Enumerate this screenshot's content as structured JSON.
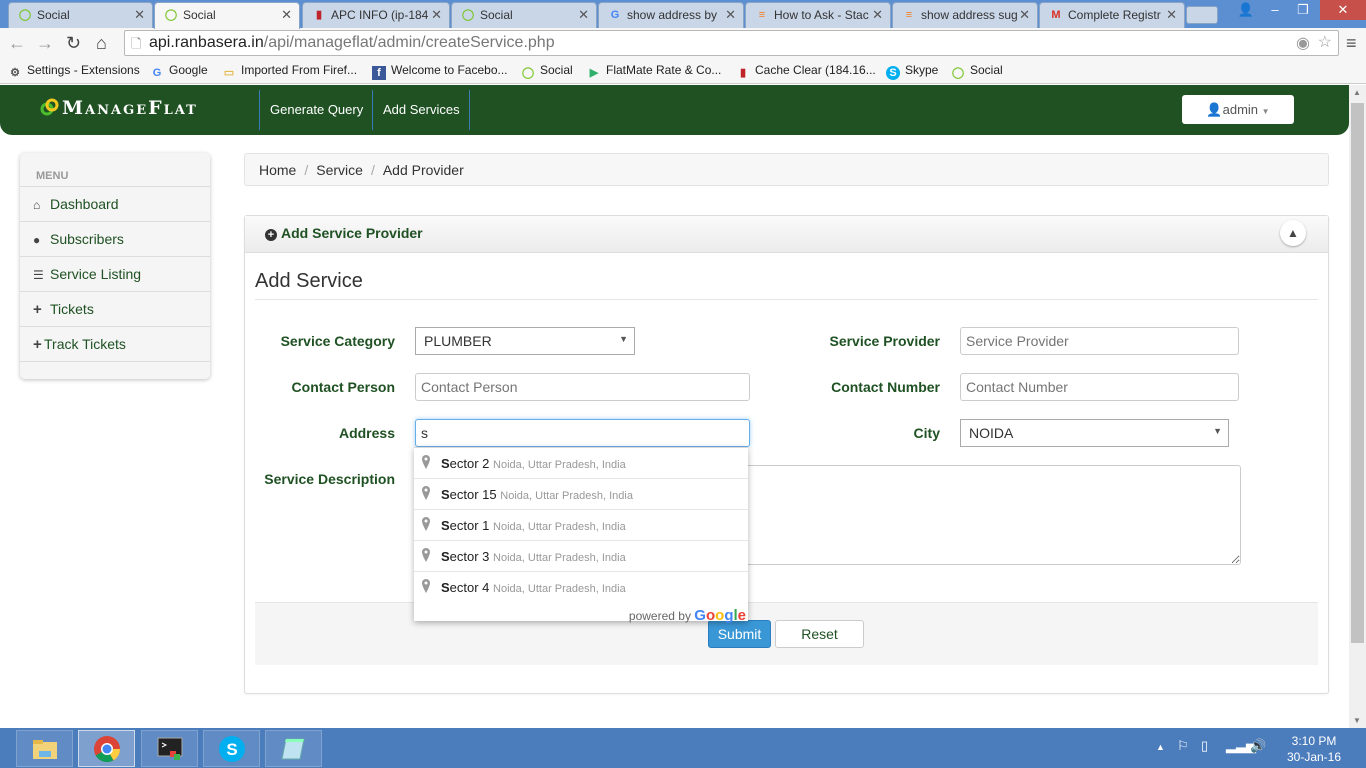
{
  "browser": {
    "tabs": [
      {
        "title": "Social",
        "icon": "social-icon",
        "active": false
      },
      {
        "title": "Social",
        "icon": "social-icon",
        "active": true
      },
      {
        "title": "APC INFO (ip-184",
        "icon": "extinguisher-icon",
        "active": false
      },
      {
        "title": "Social",
        "icon": "social-icon",
        "active": false
      },
      {
        "title": "show address by",
        "icon": "google-icon",
        "active": false
      },
      {
        "title": "How to Ask - Stac",
        "icon": "stackoverflow-icon",
        "active": false
      },
      {
        "title": "show address sug",
        "icon": "stackoverflow-icon",
        "active": false
      },
      {
        "title": "Complete Registr",
        "icon": "gmail-icon",
        "active": false
      }
    ],
    "url_host": "api.ranbasera.in",
    "url_path": "/api/manageflat/admin/createService.php",
    "bookmarks": [
      {
        "label": "Settings - Extensions",
        "icon": "gear-icon"
      },
      {
        "label": "Google",
        "icon": "google-icon"
      },
      {
        "label": "Imported From Firef...",
        "icon": "folder-icon"
      },
      {
        "label": "Welcome to Facebo...",
        "icon": "facebook-icon"
      },
      {
        "label": "Social",
        "icon": "social-icon"
      },
      {
        "label": "FlatMate Rate & Co...",
        "icon": "play-store-icon"
      },
      {
        "label": "Cache Clear (184.16...",
        "icon": "extinguisher-icon"
      },
      {
        "label": "Skype",
        "icon": "skype-icon"
      },
      {
        "label": "Social",
        "icon": "social-icon"
      }
    ]
  },
  "app": {
    "brand": "ManageFlat",
    "nav": [
      {
        "label": "Generate Query"
      },
      {
        "label": "Add Services"
      }
    ],
    "user": "admin",
    "colors": {
      "primary": "#1f5123",
      "submit": "#3a97d6"
    }
  },
  "sidebar": {
    "heading": "MENU",
    "items": [
      {
        "label": "Dashboard",
        "icon": "home-icon"
      },
      {
        "label": "Subscribers",
        "icon": "user-icon"
      },
      {
        "label": "Service Listing",
        "icon": "list-icon"
      },
      {
        "label": "Tickets",
        "icon": "plus-icon"
      },
      {
        "label": "Track Tickets",
        "icon": "plus-icon"
      }
    ]
  },
  "breadcrumb": {
    "items": [
      "Home",
      "Service",
      "Add Provider"
    ],
    "separator": "/"
  },
  "panel": {
    "title": "Add Service Provider",
    "form_title": "Add Service",
    "fields": {
      "service_category": {
        "label": "Service Category",
        "value": "PLUMBER"
      },
      "service_provider": {
        "label": "Service Provider",
        "placeholder": "Service Provider",
        "value": ""
      },
      "contact_person": {
        "label": "Contact Person",
        "placeholder": "Contact Person",
        "value": ""
      },
      "contact_number": {
        "label": "Contact Number",
        "placeholder": "Contact Number",
        "value": ""
      },
      "address": {
        "label": "Address",
        "value": "s"
      },
      "city": {
        "label": "City",
        "value": "NOIDA"
      },
      "service_description": {
        "label": "Service Description",
        "value": ""
      }
    },
    "submit_label": "Submit",
    "reset_label": "Reset"
  },
  "autocomplete": {
    "suggestions": [
      {
        "match": "S",
        "rest": "ector 2",
        "secondary": "Noida, Uttar Pradesh, India"
      },
      {
        "match": "S",
        "rest": "ector 15",
        "secondary": "Noida, Uttar Pradesh, India"
      },
      {
        "match": "S",
        "rest": "ector 1",
        "secondary": "Noida, Uttar Pradesh, India"
      },
      {
        "match": "S",
        "rest": "ector 3",
        "secondary": "Noida, Uttar Pradesh, India"
      },
      {
        "match": "S",
        "rest": "ector 4",
        "secondary": "Noida, Uttar Pradesh, India"
      }
    ],
    "powered_by": "powered by",
    "google": [
      "G",
      "o",
      "o",
      "g",
      "l",
      "e"
    ],
    "google_colors": [
      "#4285f4",
      "#ea4335",
      "#fbbc05",
      "#4285f4",
      "#34a853",
      "#ea4335"
    ]
  },
  "taskbar": {
    "apps": [
      {
        "name": "File Explorer",
        "icon": "file-explorer-icon"
      },
      {
        "name": "Chrome",
        "icon": "chrome-icon",
        "active": true
      },
      {
        "name": "Command Prompt",
        "icon": "terminal-icon"
      },
      {
        "name": "Skype",
        "icon": "skype-icon"
      },
      {
        "name": "Notepad",
        "icon": "notepad-icon"
      }
    ],
    "time": "3:10 PM",
    "date": "30-Jan-16"
  }
}
